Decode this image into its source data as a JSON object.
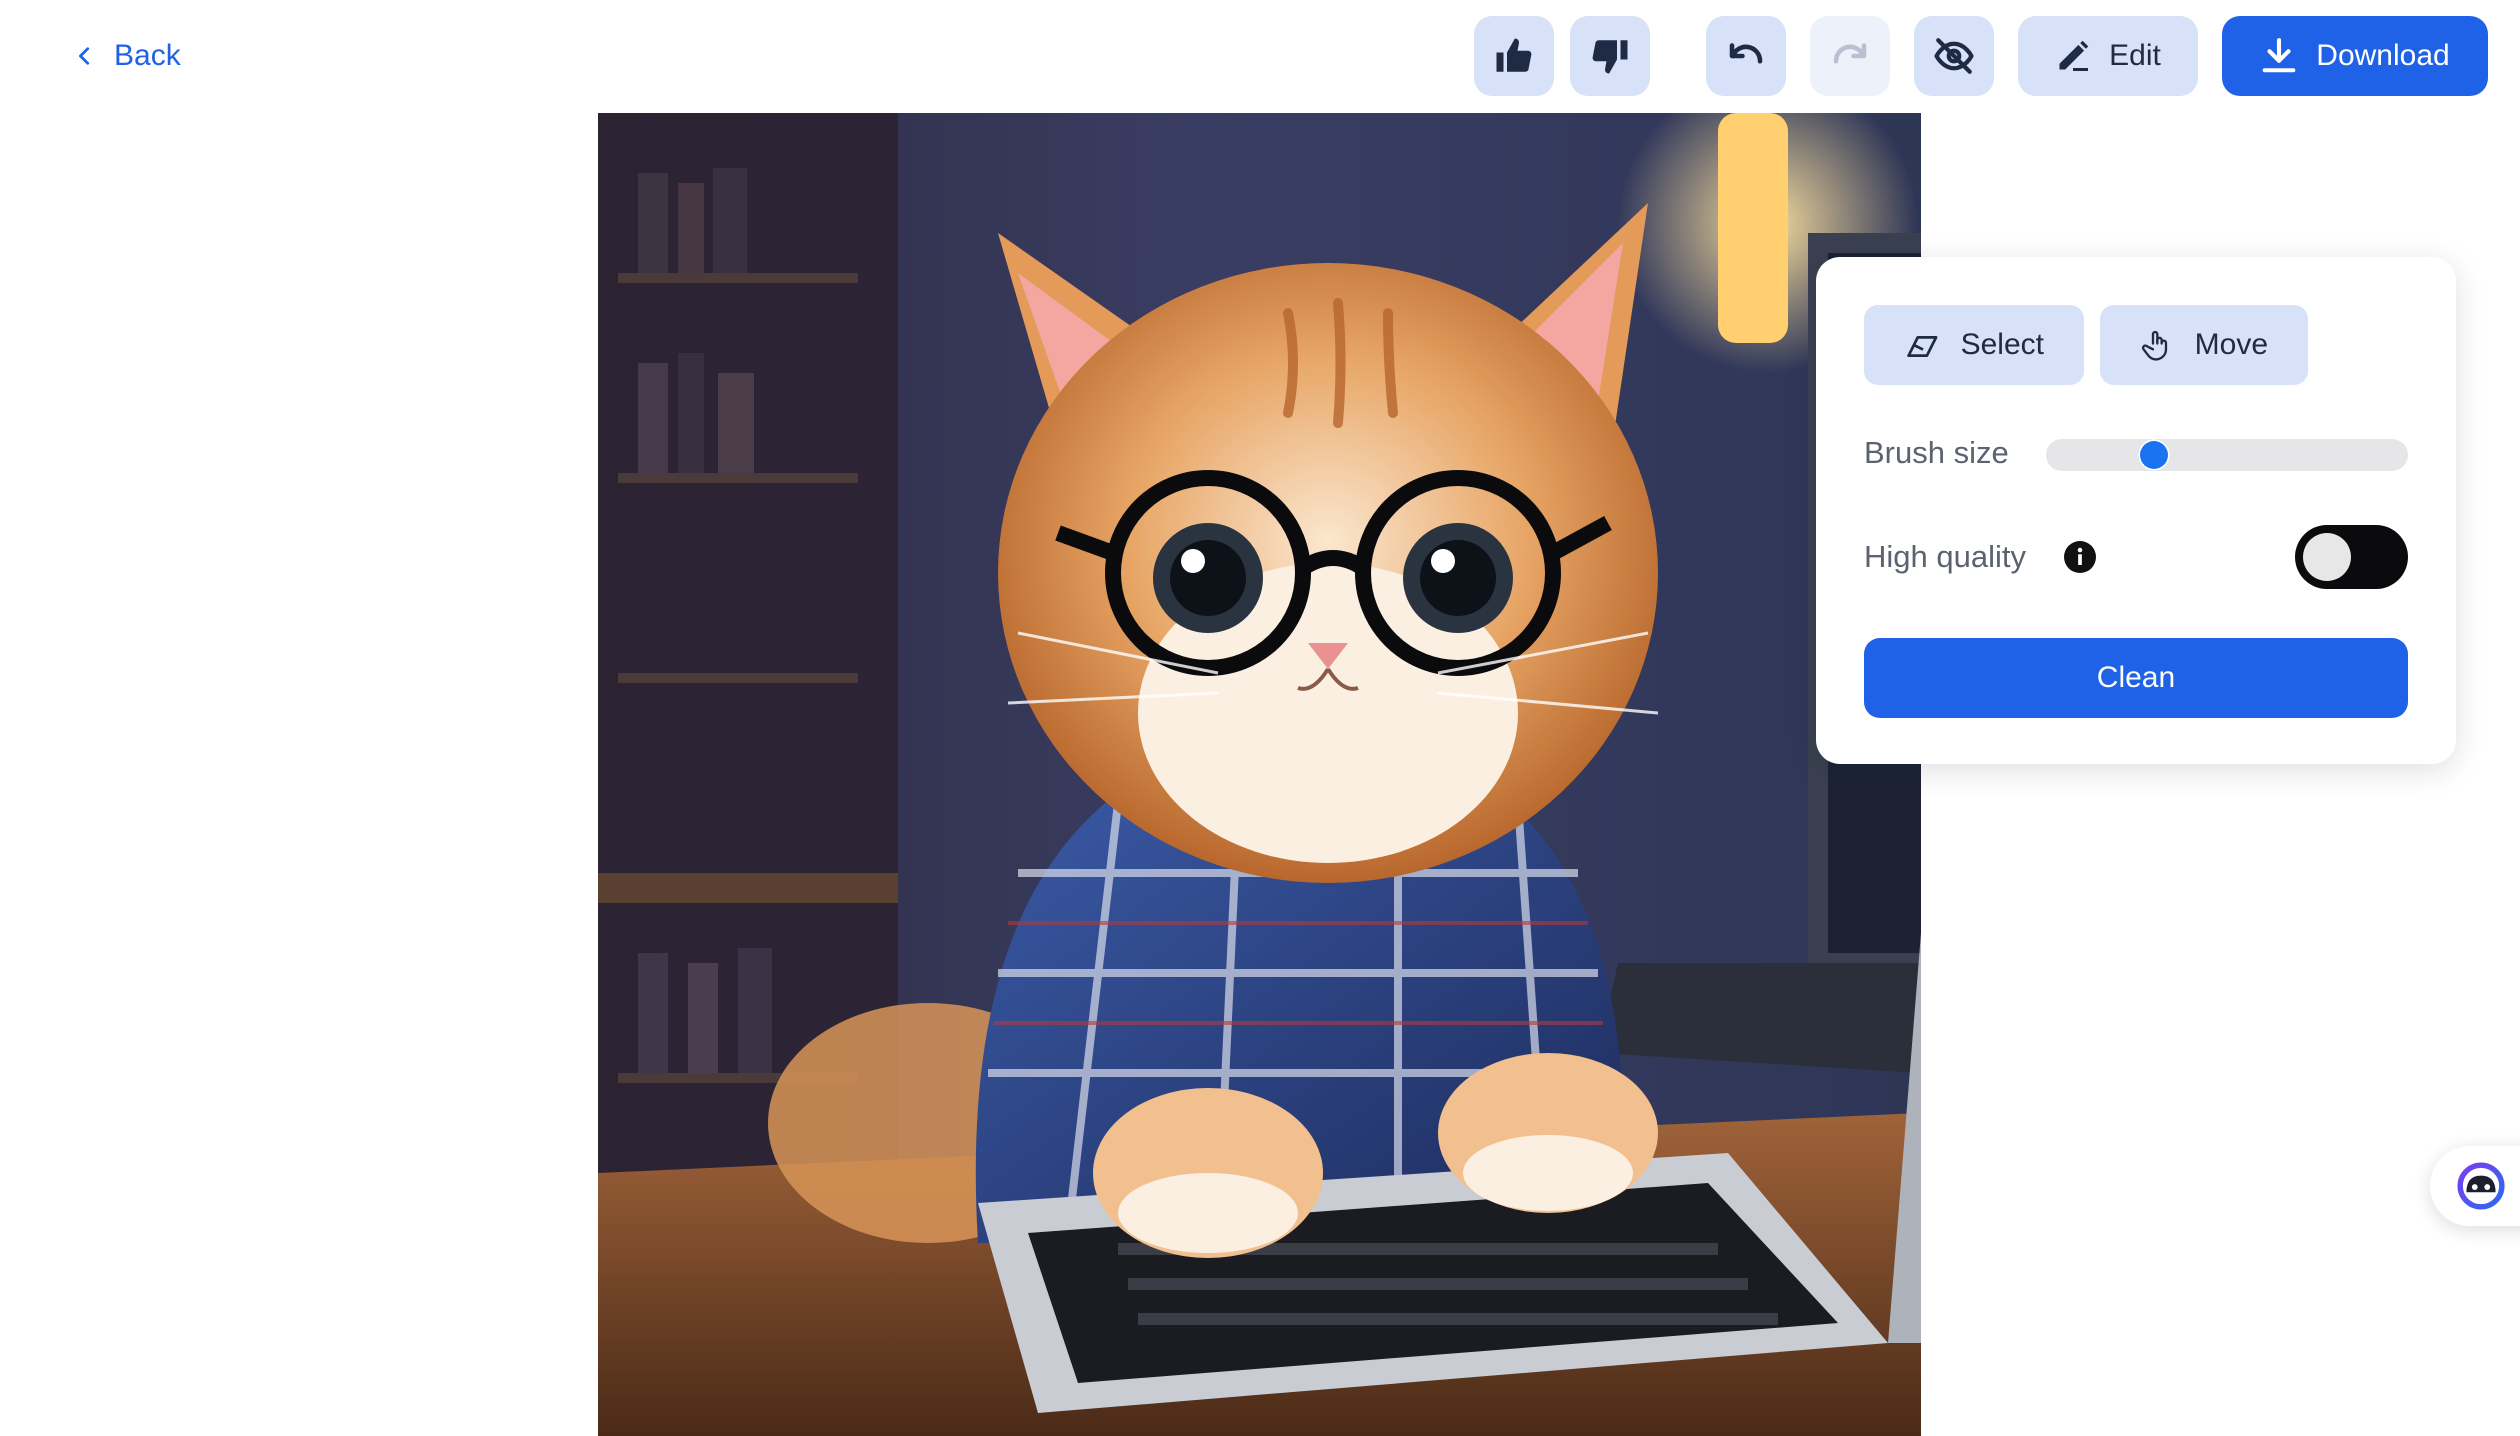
{
  "header": {
    "back_label": "Back",
    "edit_label": "Edit",
    "download_label": "Download",
    "icons": {
      "back": "chevron-left-icon",
      "like": "thumbs-up-icon",
      "dislike": "thumbs-down-icon",
      "undo": "undo-icon",
      "redo": "redo-icon",
      "hide": "eye-off-icon",
      "edit": "pencil-icon",
      "download": "download-icon"
    },
    "redo_disabled": true
  },
  "canvas": {
    "description_icon": "cat-photo"
  },
  "panel": {
    "select_label": "Select",
    "move_label": "Move",
    "brush_size_label": "Brush size",
    "brush_size_fraction": 0.28,
    "high_quality_label": "High quality",
    "high_quality_on": false,
    "clean_label": "Clean"
  },
  "colors": {
    "accent": "#1f62e8",
    "button_bg": "#d7e1f7",
    "slider_thumb": "#1a73f0",
    "toggle_bg": "#0b0b0e"
  }
}
